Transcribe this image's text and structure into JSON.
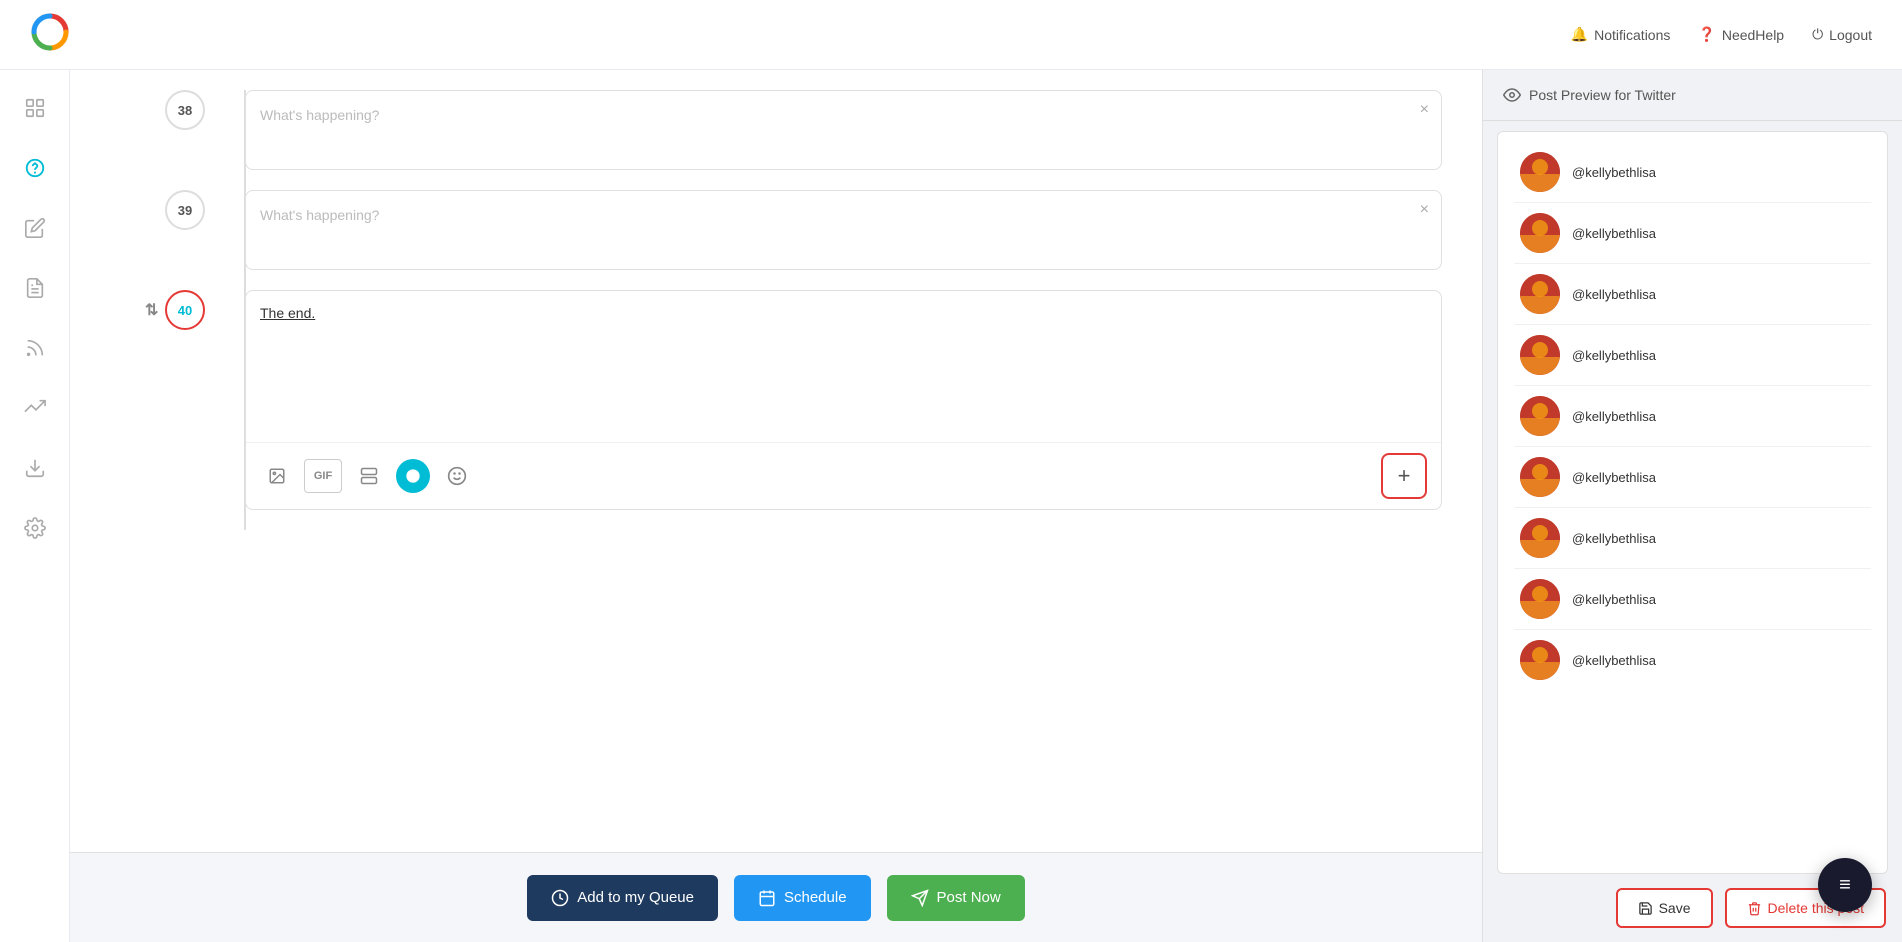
{
  "header": {
    "notifications_label": "Notifications",
    "needhelp_label": "NeedHelp",
    "logout_label": "Logout"
  },
  "sidebar": {
    "items": [
      {
        "name": "dashboard",
        "icon": "⊞"
      },
      {
        "name": "billing",
        "icon": "💲"
      },
      {
        "name": "compose",
        "icon": "✏️"
      },
      {
        "name": "posts",
        "icon": "📋"
      },
      {
        "name": "feed",
        "icon": "📡"
      },
      {
        "name": "analytics",
        "icon": "🔄"
      },
      {
        "name": "download",
        "icon": "⬇"
      },
      {
        "name": "settings",
        "icon": "⚙"
      }
    ]
  },
  "thread": {
    "tweet38": {
      "number": "38",
      "placeholder": "What's happening?"
    },
    "tweet39": {
      "number": "39",
      "placeholder": "What's happening?"
    },
    "tweet40": {
      "number": "40",
      "content": "The end.",
      "highlighted": true
    }
  },
  "toolbar": {
    "gif_label": "GIF",
    "add_tweet_label": "+"
  },
  "preview": {
    "title": "Post Preview for Twitter",
    "username": "@kellybethlisa",
    "accounts": [
      {
        "id": 1,
        "username": "@kellybethlisa"
      },
      {
        "id": 2,
        "username": "@kellybethlisa"
      },
      {
        "id": 3,
        "username": "@kellybethlisa"
      },
      {
        "id": 4,
        "username": "@kellybethlisa"
      },
      {
        "id": 5,
        "username": "@kellybethlisa"
      },
      {
        "id": 6,
        "username": "@kellybethlisa"
      },
      {
        "id": 7,
        "username": "@kellybethlisa"
      },
      {
        "id": 8,
        "username": "@kellybethlisa"
      },
      {
        "id": 9,
        "username": "@kellybethlisa"
      }
    ],
    "save_label": "Save",
    "delete_label": "Delete this post"
  },
  "bottom_actions": {
    "queue_label": "Add to my Queue",
    "schedule_label": "Schedule",
    "postnow_label": "Post Now"
  },
  "fab": {
    "icon": "≡"
  }
}
